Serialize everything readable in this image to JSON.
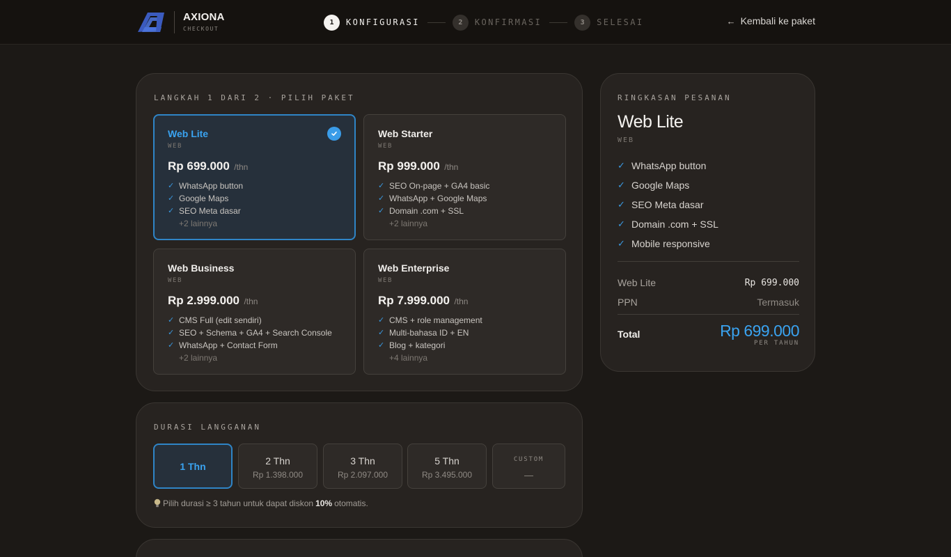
{
  "header": {
    "brand": "AXIONA",
    "brand_sub": "CHECKOUT",
    "steps": [
      {
        "num": "1",
        "label": "KONFIGURASI"
      },
      {
        "num": "2",
        "label": "KONFIRMASI"
      },
      {
        "num": "3",
        "label": "SELESAI"
      }
    ],
    "back_label": "Kembali ke paket"
  },
  "packages": {
    "eyebrow": "LANGKAH 1 DARI 2 · PILIH PAKET",
    "items": [
      {
        "name": "Web Lite",
        "category": "WEB",
        "price": "Rp 699.000",
        "per": "/thn",
        "features": [
          "WhatsApp button",
          "Google Maps",
          "SEO Meta dasar"
        ],
        "more": "+2 lainnya"
      },
      {
        "name": "Web Starter",
        "category": "WEB",
        "price": "Rp 999.000",
        "per": "/thn",
        "features": [
          "SEO On-page + GA4 basic",
          "WhatsApp + Google Maps",
          "Domain .com + SSL"
        ],
        "more": "+2 lainnya"
      },
      {
        "name": "Web Business",
        "category": "WEB",
        "price": "Rp 2.999.000",
        "per": "/thn",
        "features": [
          "CMS Full (edit sendiri)",
          "SEO + Schema + GA4 + Search Console",
          "WhatsApp + Contact Form"
        ],
        "more": "+2 lainnya"
      },
      {
        "name": "Web Enterprise",
        "category": "WEB",
        "price": "Rp 7.999.000",
        "per": "/thn",
        "features": [
          "CMS + role management",
          "Multi-bahasa ID + EN",
          "Blog + kategori"
        ],
        "more": "+4 lainnya"
      }
    ]
  },
  "duration": {
    "eyebrow": "DURASI LANGGANAN",
    "options": [
      {
        "label": "1 Thn",
        "price": ""
      },
      {
        "label": "2 Thn",
        "price": "Rp 1.398.000"
      },
      {
        "label": "3 Thn",
        "price": "Rp 2.097.000"
      },
      {
        "label": "5 Thn",
        "price": "Rp 3.495.000"
      },
      {
        "label": "CUSTOM",
        "price": "—"
      }
    ],
    "hint_pre": "Pilih durasi ≥ 3 tahun untuk dapat diskon",
    "hint_bold": "10%",
    "hint_post": "otomatis."
  },
  "summary": {
    "eyebrow": "RINGKASAN PESANAN",
    "title": "Web Lite",
    "category": "WEB",
    "features": [
      "WhatsApp button",
      "Google Maps",
      "SEO Meta dasar",
      "Domain .com + SSL",
      "Mobile responsive"
    ],
    "line_label": "Web Lite",
    "line_value": "Rp 699.000",
    "tax_label": "PPN",
    "tax_value": "Termasuk",
    "total_label": "Total",
    "total_value": "Rp 699.000",
    "total_per": "PER TAHUN"
  },
  "colors": {
    "accent": "#3aa3f0",
    "background": "#1c1916",
    "panel": "#272320",
    "selected_bg": "#26303b"
  }
}
